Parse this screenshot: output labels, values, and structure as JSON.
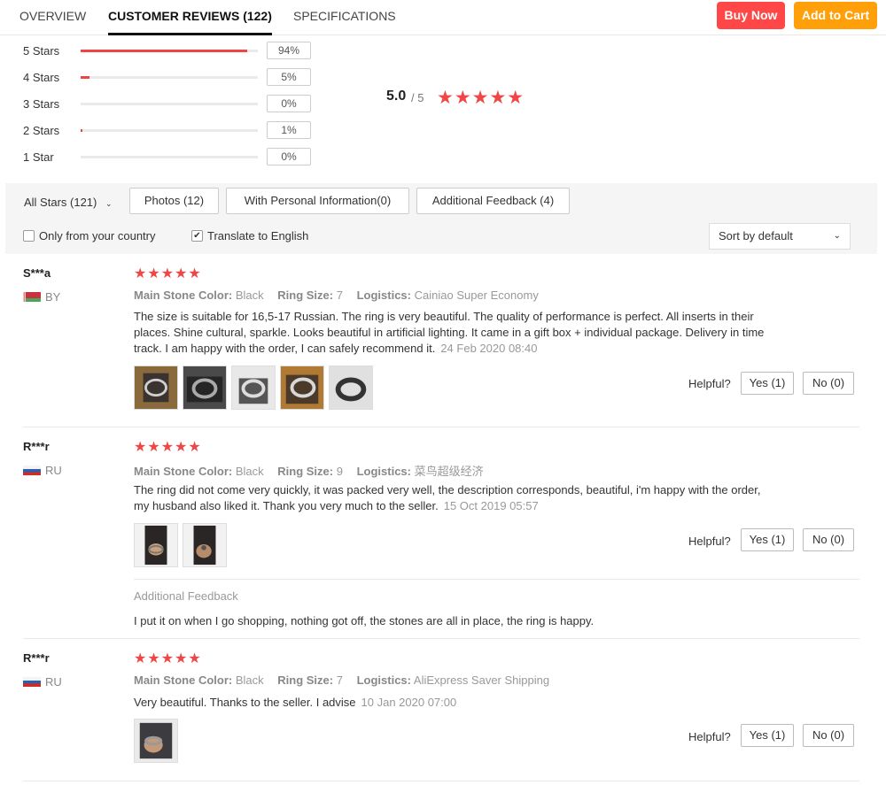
{
  "tabs": [
    {
      "label": "OVERVIEW",
      "active": false
    },
    {
      "label": "CUSTOMER REVIEWS (122)",
      "active": true
    },
    {
      "label": "SPECIFICATIONS",
      "active": false
    }
  ],
  "actions": {
    "buy_now": "Buy Now",
    "add_to_cart": "Add to Cart"
  },
  "breakdown": [
    {
      "label": "5 Stars",
      "pct": "94%",
      "value": 0.94
    },
    {
      "label": "4 Stars",
      "pct": "5%",
      "value": 0.05
    },
    {
      "label": "3 Stars",
      "pct": "0%",
      "value": 0
    },
    {
      "label": "2 Stars",
      "pct": "1%",
      "value": 0.01
    },
    {
      "label": "1 Star",
      "pct": "0%",
      "value": 0
    }
  ],
  "average": {
    "score": "5.0",
    "out_of": "/ 5",
    "stars": "★★★★★"
  },
  "filters": {
    "all_stars": "All Stars (121)",
    "photos": "Photos (12)",
    "personal_info": "With Personal Information(0)",
    "additional_feedback": "Additional Feedback (4)",
    "only_country": "Only from your country",
    "only_country_checked": false,
    "translate": "Translate to English",
    "translate_checked": true,
    "sort": "Sort by default"
  },
  "labels": {
    "stone_color": "Main Stone Color:",
    "ring_size": "Ring Size:",
    "logistics": "Logistics:",
    "helpful": "Helpful?",
    "additional_feedback": "Additional Feedback"
  },
  "reviews": [
    {
      "name": "S***a",
      "country": "BY",
      "stars": "★★★★★",
      "stone_color": "Black",
      "ring_size": "7",
      "logistics": "Cainiao Super Economy",
      "text": "The size is suitable for 16,5-17 Russian. The ring is very beautiful. The quality of performance is perfect. All inserts in their places. Shine cultural, sparkle. Looks beautiful in artificial lighting. It came in a gift box + individual package. Delivery in time track. I am happy with the order, I can safely recommend it.",
      "date": "24 Feb 2020 08:40",
      "yes": "Yes (1)",
      "no": "No (0)"
    },
    {
      "name": "R***r",
      "country": "RU",
      "stars": "★★★★★",
      "stone_color": "Black",
      "ring_size": "9",
      "logistics": "菜鸟超级经济",
      "text": "The ring did not come very quickly, it was packed very well, the description corresponds, beautiful, i'm happy with the order, my husband also liked it. Thank you very much to the seller.",
      "date": "15 Oct 2019 05:57",
      "yes": "Yes (1)",
      "no": "No (0)",
      "additional_feedback": "I put it on when I go shopping, nothing got off, the stones are all in place, the ring is happy."
    },
    {
      "name": "R***r",
      "country": "RU",
      "stars": "★★★★★",
      "stone_color": "Black",
      "ring_size": "7",
      "logistics": "AliExpress Saver Shipping",
      "text": "Very beautiful. Thanks to the seller. I advise",
      "date": "10 Jan 2020 07:00",
      "yes": "Yes (1)",
      "no": "No (0)"
    }
  ]
}
